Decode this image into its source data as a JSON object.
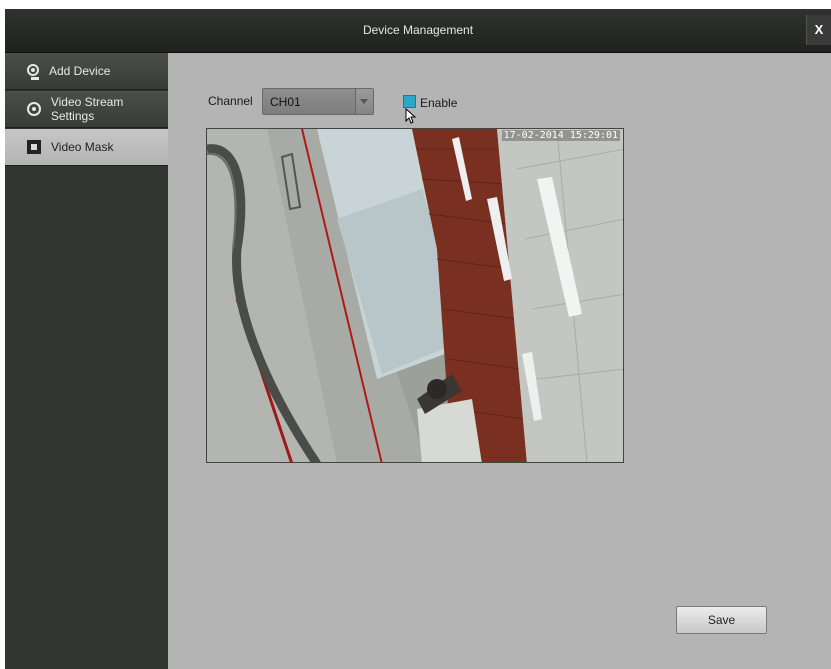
{
  "window": {
    "title": "Device Management",
    "close_label": "X"
  },
  "sidebar": {
    "items": [
      {
        "label": "Add Device",
        "icon": "camera-icon",
        "active": false
      },
      {
        "label": "Video Stream Settings",
        "icon": "stream-settings-icon",
        "active": false
      },
      {
        "label": "Video Mask",
        "icon": "video-mask-icon",
        "active": true
      }
    ]
  },
  "main": {
    "channel_label": "Channel",
    "channel_value": "CH01",
    "enable_label": "Enable",
    "enable_checked": true,
    "video_timestamp": "17-02-2014 15:29:01",
    "save_label": "Save"
  },
  "colors": {
    "accent": "#2aa8c8",
    "titlebar": "#2a2e2a",
    "sidebar": "#303530",
    "content_bg": "#b4b4b4"
  }
}
